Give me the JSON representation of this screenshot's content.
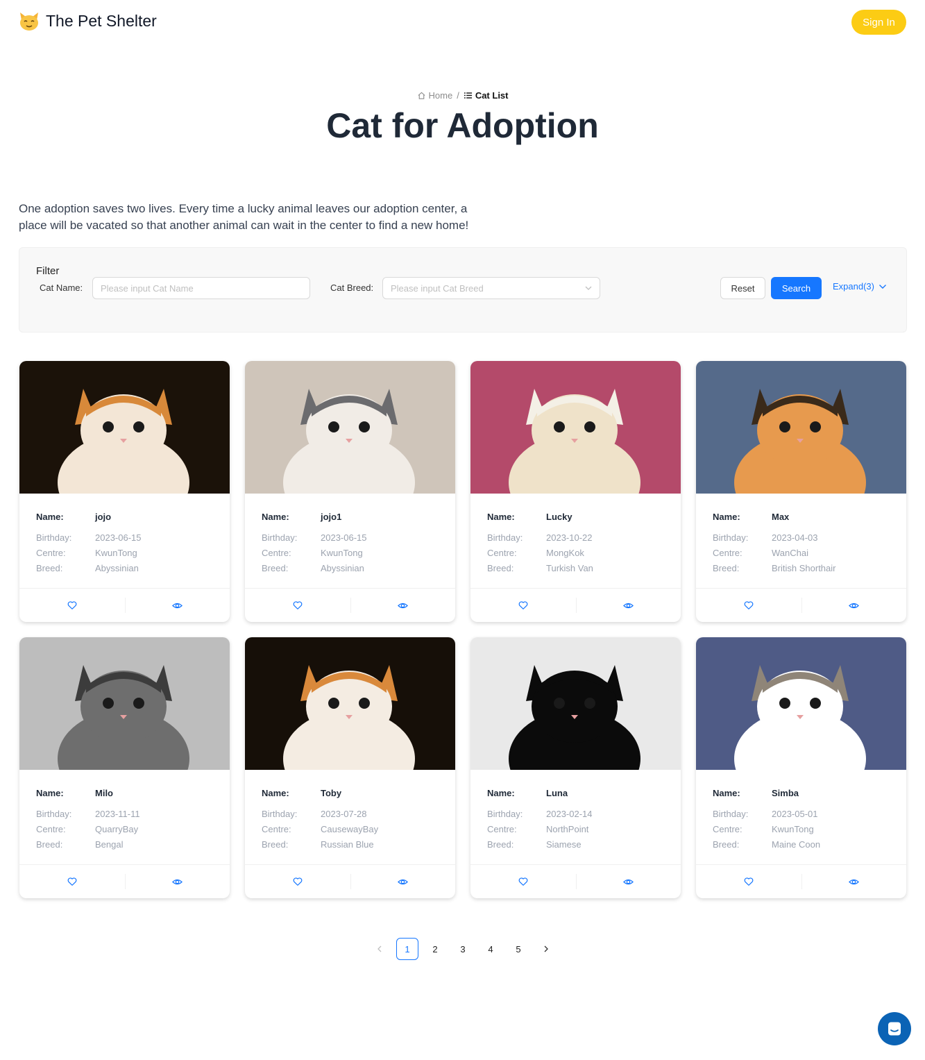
{
  "brand": {
    "name": "The Pet Shelter",
    "logo_icon": "cat-face-icon"
  },
  "header": {
    "signin_label": "Sign In"
  },
  "breadcrumb": {
    "home": "Home",
    "separator": "/",
    "current": "Cat List"
  },
  "page": {
    "title": "Cat for Adoption",
    "intro": " One adoption saves two lives. Every time a lucky animal leaves our adoption center, a place will be vacated so that another animal can wait in the center to find a new home!"
  },
  "filter": {
    "title": "Filter",
    "cat_name_label": "Cat Name",
    "cat_name_placeholder": "Please input Cat Name",
    "cat_breed_label": "Cat Breed",
    "cat_breed_placeholder": "Please input Cat Breed",
    "reset_label": "Reset",
    "search_label": "Search",
    "expand_label": "Expand(3)"
  },
  "labels": {
    "name": "Name:",
    "birthday": "Birthday:",
    "centre": "Centre:",
    "breed": "Breed:"
  },
  "cats": [
    {
      "name": "jojo",
      "birthday": "2023-06-15",
      "centre": "KwunTong",
      "breed": "Abyssinian"
    },
    {
      "name": "jojo1",
      "birthday": "2023-06-15",
      "centre": "KwunTong",
      "breed": "Abyssinian"
    },
    {
      "name": "Lucky",
      "birthday": "2023-10-22",
      "centre": "MongKok",
      "breed": "Turkish Van"
    },
    {
      "name": "Max",
      "birthday": "2023-04-03",
      "centre": "WanChai",
      "breed": "British Shorthair"
    },
    {
      "name": "Milo",
      "birthday": "2023-11-11",
      "centre": "QuarryBay",
      "breed": "Bengal"
    },
    {
      "name": "Toby",
      "birthday": "2023-07-28",
      "centre": "CausewayBay",
      "breed": "Russian Blue"
    },
    {
      "name": "Luna",
      "birthday": "2023-02-14",
      "centre": "NorthPoint",
      "breed": "Siamese"
    },
    {
      "name": "Simba",
      "birthday": "2023-05-01",
      "centre": "KwunTong",
      "breed": "Maine Coon"
    }
  ],
  "pagination": {
    "pages": [
      "1",
      "2",
      "3",
      "4",
      "5"
    ],
    "current": "1"
  },
  "colors": {
    "accent": "#1677ff",
    "signin": "#fccc14",
    "title": "#1f2937",
    "chat": "#0b63b5"
  }
}
